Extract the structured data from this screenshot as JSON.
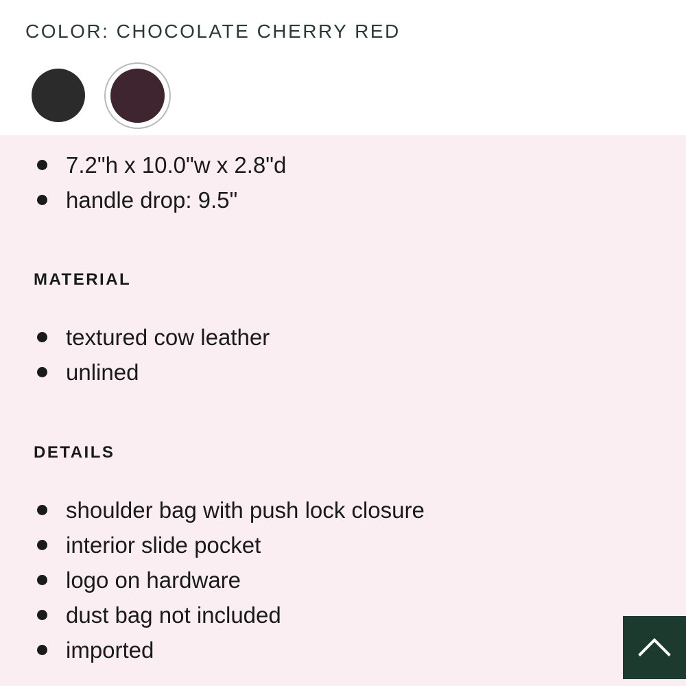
{
  "color": {
    "label": "COLOR: CHOCOLATE CHERRY RED",
    "swatches": [
      {
        "name": "black",
        "hex": "#2b2b2b",
        "selected": false
      },
      {
        "name": "chocolate cherry red",
        "hex": "#3e2530",
        "selected": true
      }
    ]
  },
  "dimensions": {
    "items": [
      "7.2\"h x 10.0\"w x 2.8\"d",
      "handle drop: 9.5\""
    ]
  },
  "material": {
    "heading": "MATERIAL",
    "items": [
      "textured cow leather",
      "unlined"
    ]
  },
  "details": {
    "heading": "DETAILS",
    "items": [
      "shoulder bag with push lock closure",
      "interior slide pocket",
      "logo on hardware",
      "dust bag not included",
      "imported"
    ]
  },
  "scroll_top": {
    "icon": "chevron-up-icon",
    "bg": "#1c3a2e"
  },
  "colors": {
    "info_bg": "#fbeef2"
  }
}
